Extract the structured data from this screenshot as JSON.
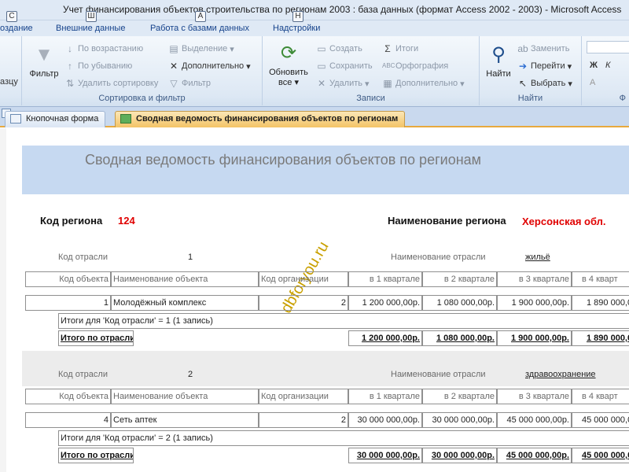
{
  "window": {
    "title": "Учет финансирования объектов строительства по регионам 2003 : база данных (формат Access 2002 - 2003)  -  Microsoft Access"
  },
  "ribbon_tabs": [
    {
      "label": "оздание",
      "keytip": "С"
    },
    {
      "label": "Внешние данные",
      "keytip": "Ш"
    },
    {
      "label": "Работа с базами данных",
      "keytip": "А"
    },
    {
      "label": "Надстройки",
      "keytip": "Н"
    }
  ],
  "ribbon": {
    "clipboard_label": "азцу",
    "sort_filter": {
      "filter": "Фильтр",
      "ascending": "По возрастанию",
      "descending": "По убыванию",
      "remove_sort": "Удалить сортировку",
      "selection": "Выделение",
      "advanced": "Дополнительно",
      "toggle_filter": "Фильтр",
      "group_label": "Сортировка и фильтр"
    },
    "records": {
      "refresh": "Обновить",
      "refresh2": "все",
      "new": "Создать",
      "save": "Сохранить",
      "delete": "Удалить",
      "totals": "Итоги",
      "spelling": "Орфография",
      "more": "Дополнительно",
      "group_label": "Записи"
    },
    "find": {
      "find": "Найти",
      "replace": "Заменить",
      "goto": "Перейти",
      "select": "Выбрать",
      "group_label": "Найти"
    },
    "format": {
      "bold": "Ж",
      "italic": "К",
      "font_color": "A",
      "group_label": "Ф"
    }
  },
  "doc_tabs": [
    {
      "label": "Кнопочная форма",
      "active": false
    },
    {
      "label": "Сводная ведомость финансирования объектов по регионам",
      "active": true
    }
  ],
  "report": {
    "title": "Сводная ведомость финансирования объектов по регионам",
    "region_code_label": "Код региона",
    "region_code": "124",
    "region_name_label": "Наименование региона",
    "region_name": "Херсонская обл.",
    "watermark": "dbforyou.ru",
    "columns": [
      "Код объекта",
      "Наименование объекта",
      "Код организации",
      "в 1 квартале",
      "в 2 квартале",
      "в 3 квартале",
      "в 4 кварт"
    ],
    "industries": [
      {
        "code_label": "Код отрасли",
        "code": "1",
        "name_label": "Наименование отрасли",
        "name": "жильё",
        "rows": [
          {
            "obj_code": "1",
            "obj_name": "Молодёжный комплекс",
            "org_code": "2",
            "q1": "1 200 000,00р.",
            "q2": "1 080 000,00р.",
            "q3": "1 900 000,00р.",
            "q4": "1 890 000,0"
          }
        ],
        "summary": "Итоги для 'Код отрасли' =  1 (1 запись)",
        "total_label": "Итого по отрасли:",
        "totals": {
          "q1": "1 200 000,00р.",
          "q2": "1 080 000,00р.",
          "q3": "1 900 000,00р.",
          "q4": "1 890 000,0"
        }
      },
      {
        "code_label": "Код отрасли",
        "code": "2",
        "name_label": "Наименование отрасли",
        "name": "здравоохранение",
        "rows": [
          {
            "obj_code": "4",
            "obj_name": "Сеть аптек",
            "org_code": "2",
            "q1": "30 000 000,00р.",
            "q2": "30 000 000,00р.",
            "q3": "45 000 000,00р.",
            "q4": "45 000 000,0"
          }
        ],
        "summary": "Итоги для 'Код отрасли' =  2 (1 запись)",
        "total_label": "Итого по отрасли:",
        "totals": {
          "q1": "30 000 000,00р.",
          "q2": "30 000 000,00р.",
          "q3": "45 000 000,00р.",
          "q4": "45 000 000,0"
        }
      }
    ]
  }
}
